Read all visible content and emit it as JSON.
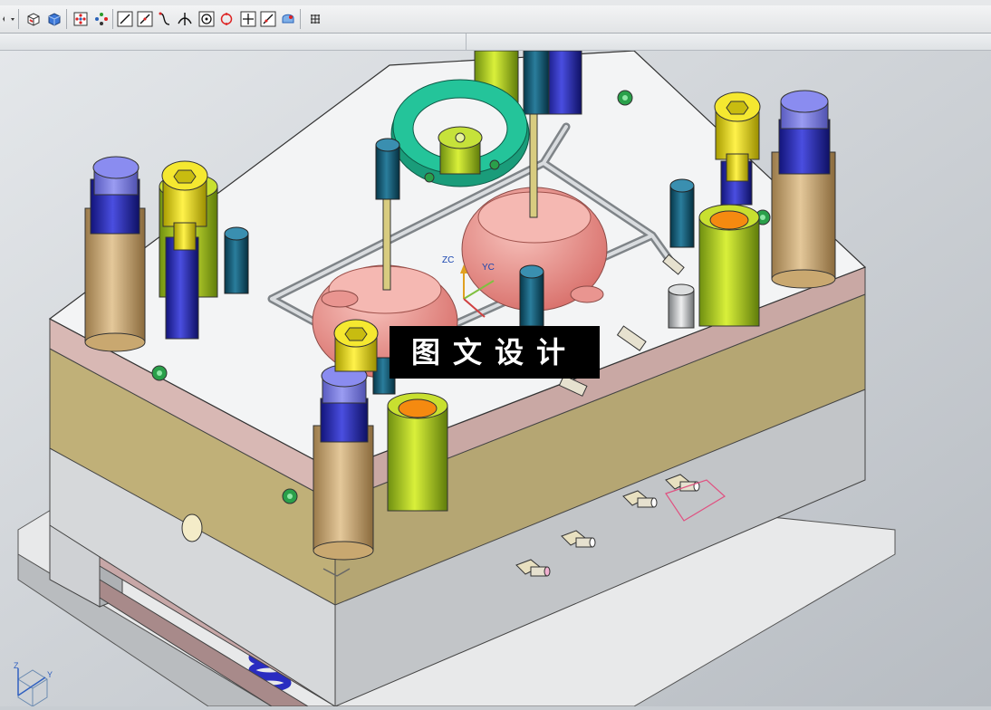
{
  "toolbar": {
    "items": [
      {
        "name": "dropdown-arrow-icon"
      },
      {
        "name": "shaded-view-icon"
      },
      {
        "name": "shaded-edges-view-icon"
      },
      {
        "name": "snap-points-icon"
      },
      {
        "name": "point-filter-icon"
      },
      {
        "name": "end-point-icon"
      },
      {
        "name": "mid-point-icon"
      },
      {
        "name": "control-point-icon"
      },
      {
        "name": "intersection-point-icon"
      },
      {
        "name": "arc-center-icon"
      },
      {
        "name": "quadrant-point-icon"
      },
      {
        "name": "existing-point-icon"
      },
      {
        "name": "point-on-curve-icon"
      },
      {
        "name": "point-on-face-icon"
      },
      {
        "name": "grid-icon"
      }
    ],
    "accent": "#2a63b8"
  },
  "viewport": {
    "wcs_labels": {
      "zc": "ZC",
      "yc": "YC"
    },
    "triad_labels": {
      "z": "Z",
      "y": "Y"
    },
    "background": "#c9ced3"
  },
  "watermark": {
    "text": "图文设计"
  }
}
